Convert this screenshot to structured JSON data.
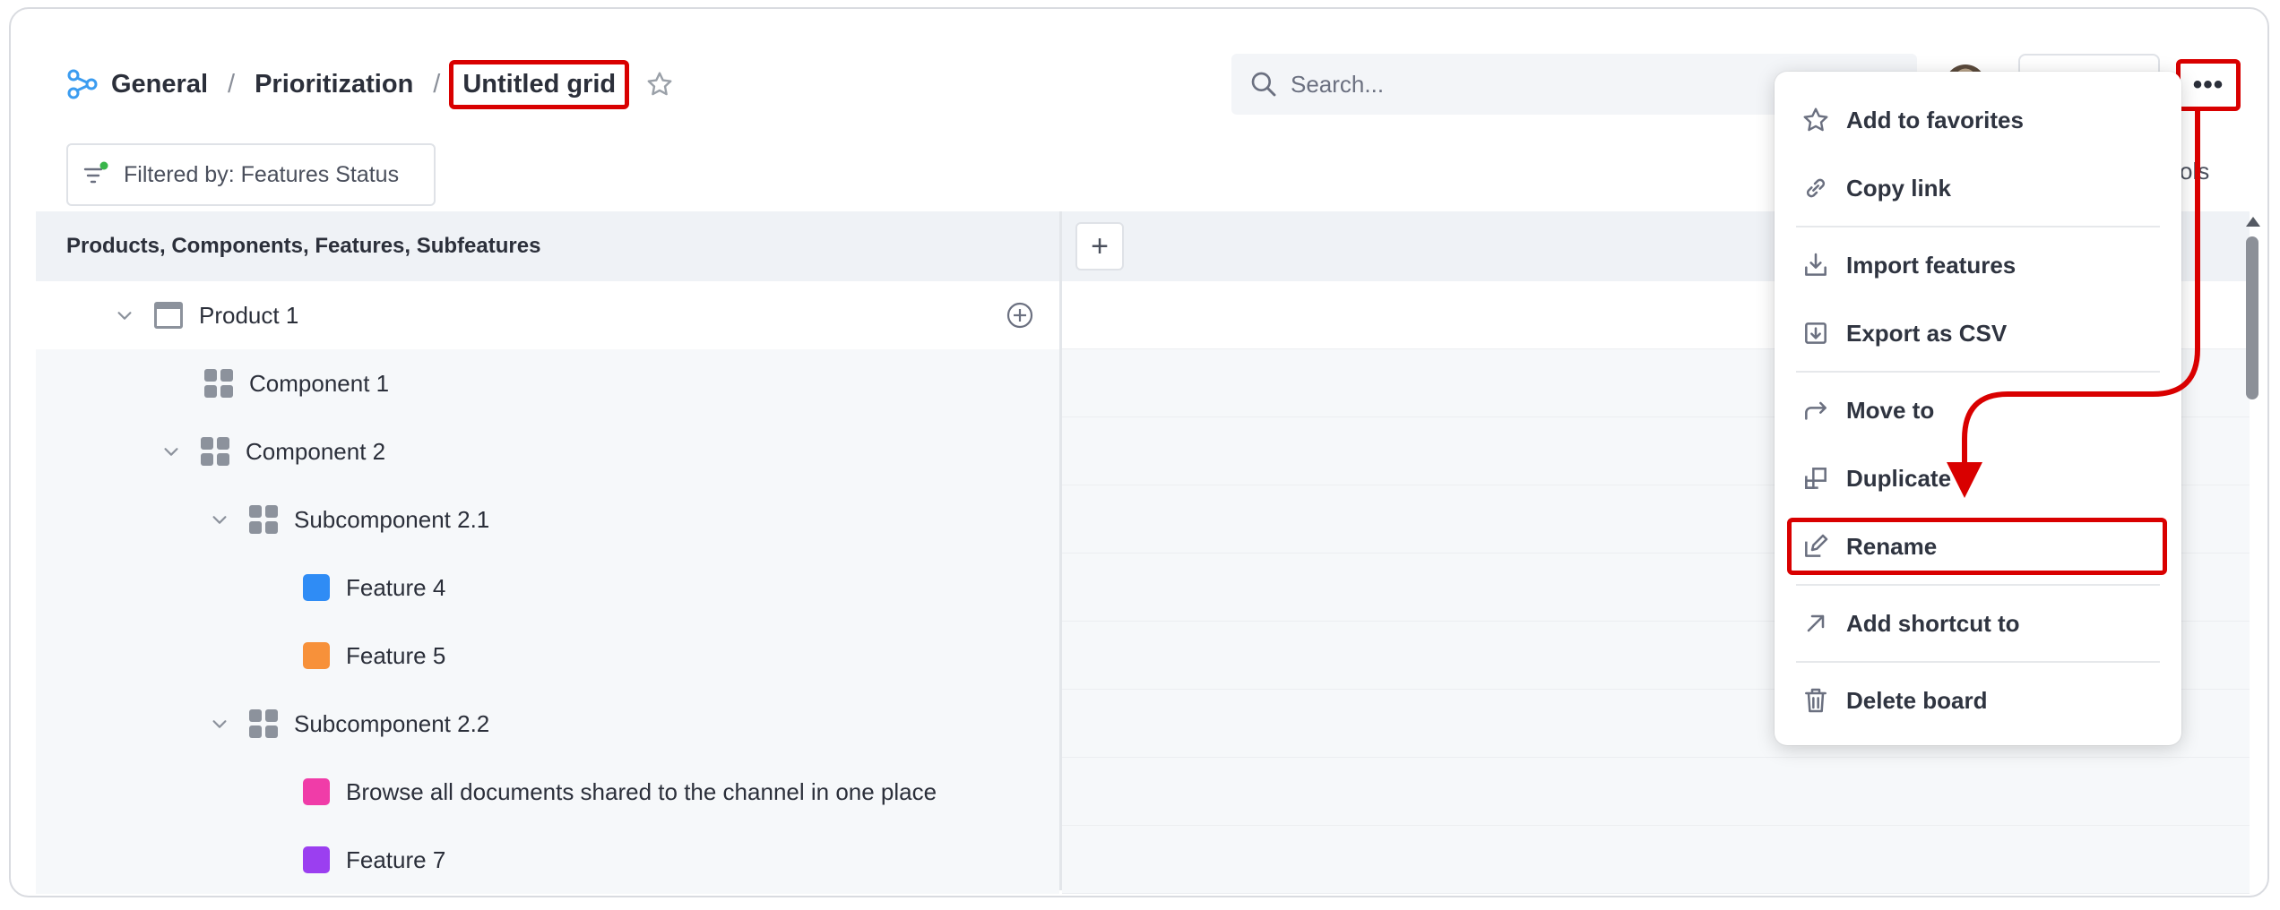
{
  "header": {
    "breadcrumb": {
      "root": "General",
      "middle": "Prioritization",
      "current": "Untitled grid",
      "separator": "/"
    },
    "search": {
      "placeholder": "Search..."
    },
    "more_label": "•••",
    "filter_label": "Filtered by: Features Status",
    "tools_label": "ols"
  },
  "grid": {
    "column_header": "Products, Components, Features, Subfeatures",
    "add_column_label": "+",
    "rows": [
      {
        "label": "Product 1",
        "icon": "window-icon"
      },
      {
        "label": "Component 1",
        "icon": "component-icon"
      },
      {
        "label": "Component 2",
        "icon": "component-icon"
      },
      {
        "label": "Subcomponent 2.1",
        "icon": "component-icon"
      },
      {
        "label": "Feature 4",
        "icon": "feature-square",
        "color": "#2f8cf5"
      },
      {
        "label": "Feature 5",
        "icon": "feature-square",
        "color": "#f7913a"
      },
      {
        "label": "Subcomponent 2.2",
        "icon": "component-icon"
      },
      {
        "label": "Browse all documents shared to the channel in one place",
        "icon": "feature-square",
        "color": "#f03ca8"
      },
      {
        "label": "Feature 7",
        "icon": "feature-square",
        "color": "#9b3ff0"
      }
    ]
  },
  "menu": {
    "items": [
      {
        "label": "Add to favorites",
        "icon": "star-icon"
      },
      {
        "label": "Copy link",
        "icon": "link-icon"
      },
      {
        "label": "Import features",
        "icon": "import-icon"
      },
      {
        "label": "Export as CSV",
        "icon": "export-icon"
      },
      {
        "label": "Move to",
        "icon": "move-icon"
      },
      {
        "label": "Duplicate",
        "icon": "duplicate-icon"
      },
      {
        "label": "Rename",
        "icon": "rename-icon"
      },
      {
        "label": "Add shortcut to",
        "icon": "shortcut-icon"
      },
      {
        "label": "Delete board",
        "icon": "trash-icon"
      }
    ]
  },
  "colors": {
    "highlight": "#d90000",
    "accent_logo": "#3b9cf0",
    "status_dot": "#39b54a"
  }
}
